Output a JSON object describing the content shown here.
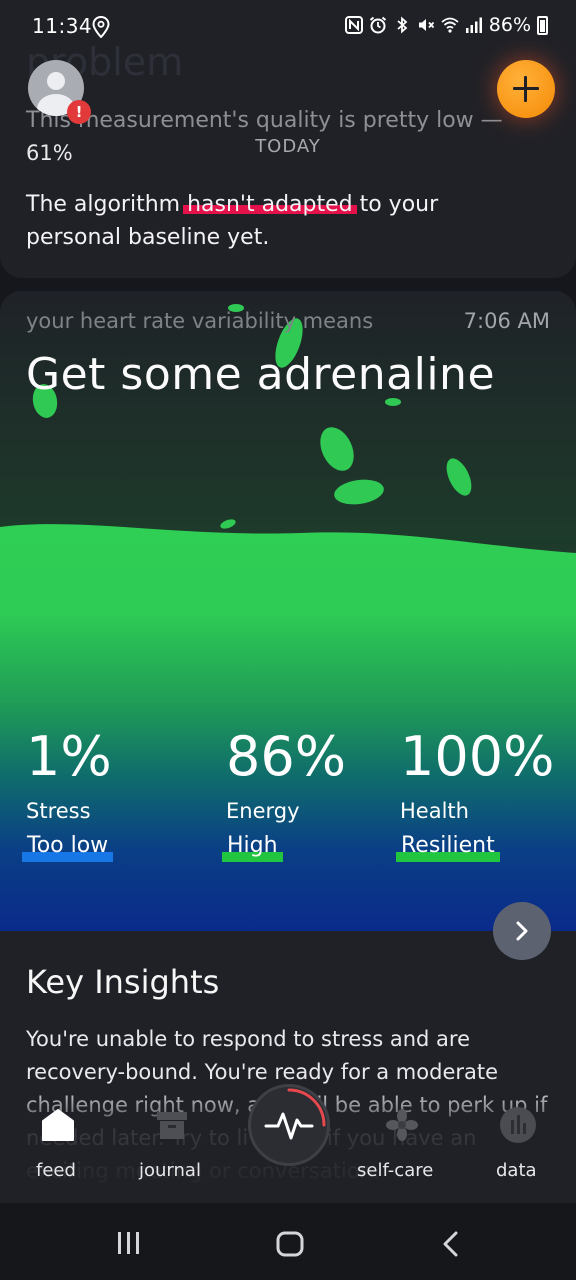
{
  "status_bar": {
    "time": "11:34",
    "battery": "86%"
  },
  "top_card": {
    "faded_title": "problem",
    "quality_prefix": "This measurement's quality is ",
    "quality_highlight": "pretty low",
    "quality_suffix": " —",
    "quality_percent": "61%",
    "date_label": "TODAY",
    "algo_prefix": "The algorithm ",
    "algo_highlight": "hasn't adapted",
    "algo_suffix": " to your personal baseline yet.",
    "alert_badge": "!"
  },
  "hrv_card": {
    "meta_label": "your heart rate variability means",
    "time": "7:06 AM",
    "headline": "Get some adrenaline",
    "metrics": [
      {
        "value": "1%",
        "label": "Stress",
        "tag": "Too low",
        "tag_color": "#1877e6"
      },
      {
        "value": "86%",
        "label": "Energy",
        "tag": "High",
        "tag_color": "#21c53f"
      },
      {
        "value": "100%",
        "label": "Health",
        "tag": "Resilient",
        "tag_color": "#21c53f"
      }
    ]
  },
  "insights": {
    "title": "Key Insights",
    "text": "You're unable to respond to stress and are recovery-bound. You're ready for a moderate challenge right now, and will be able to perk up if needed later. Try to liven up if you have an exciting meeting or conversation."
  },
  "tab_bar": {
    "items": [
      {
        "label": "feed",
        "icon": "home-icon"
      },
      {
        "label": "journal",
        "icon": "journal-icon"
      },
      {
        "label": "",
        "icon": "heartbeat-icon"
      },
      {
        "label": "self-care",
        "icon": "flower-icon"
      },
      {
        "label": "data",
        "icon": "chart-icon"
      }
    ]
  },
  "colors": {
    "accent_red": "#e4124a",
    "accent_green": "#2ecc56",
    "fab_orange": "#f7950c",
    "stress_blue": "#1877e6"
  }
}
